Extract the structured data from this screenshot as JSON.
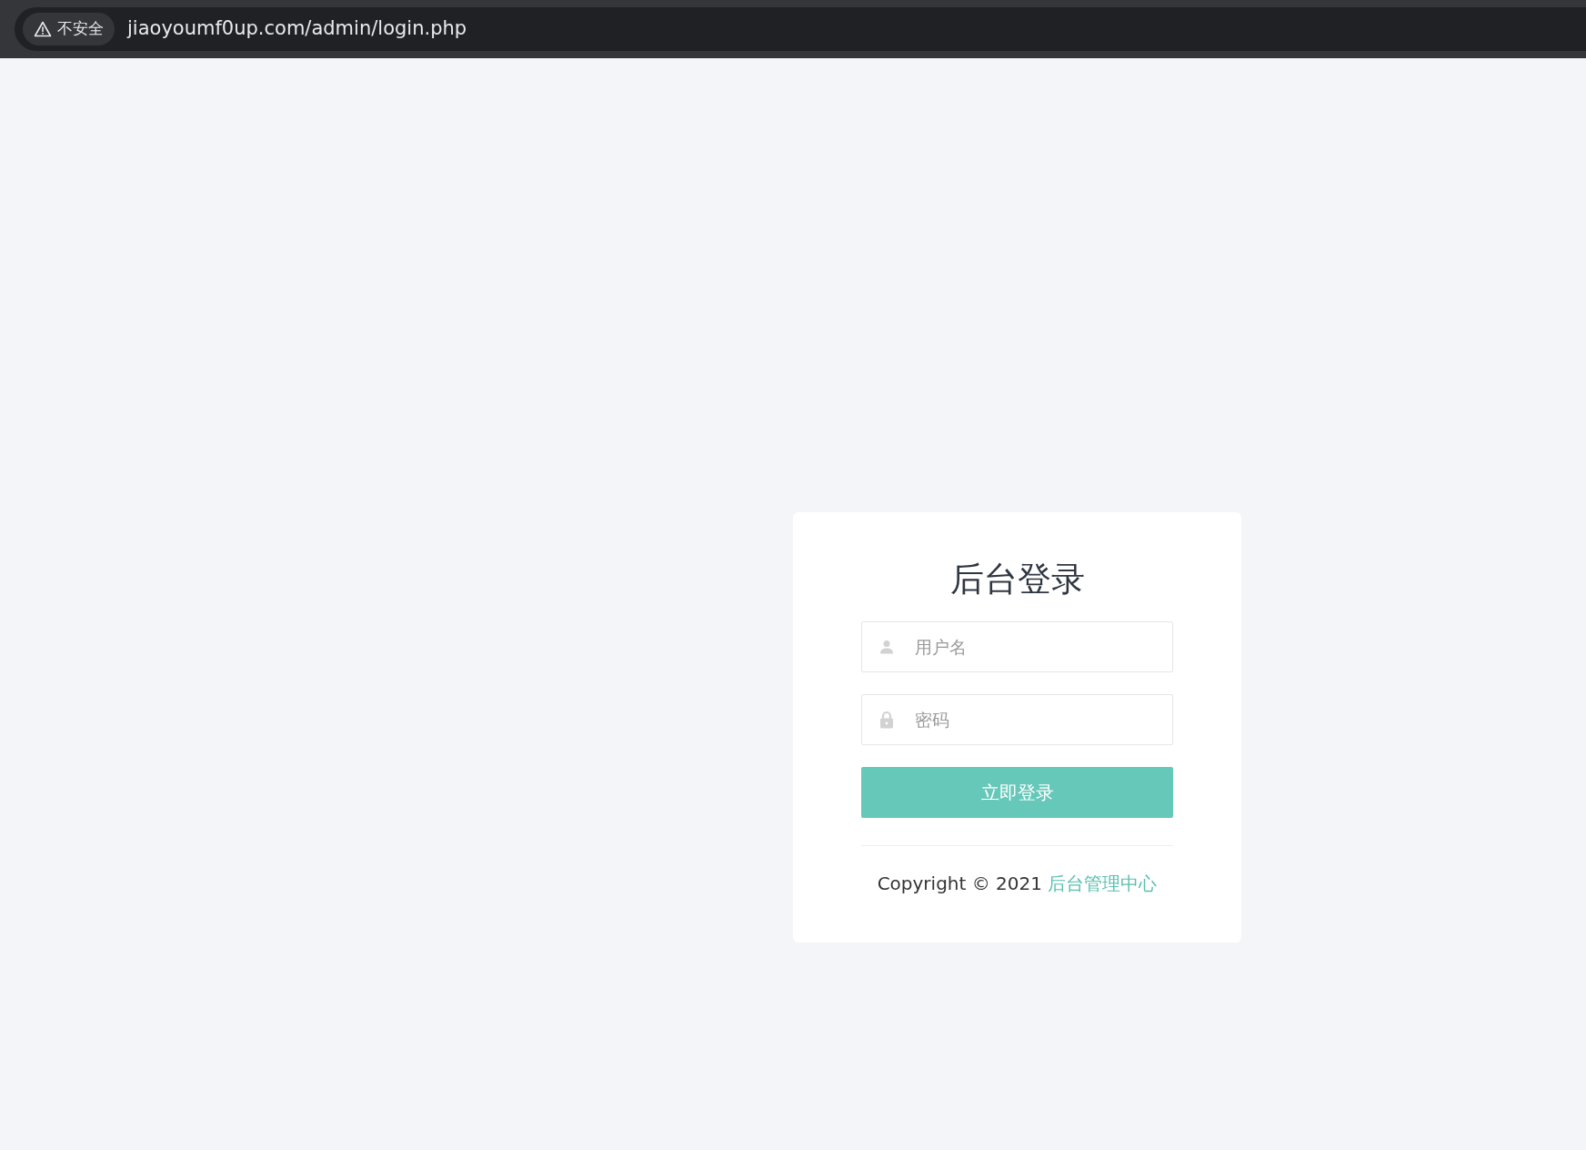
{
  "browser": {
    "security_label": "不安全",
    "url": "jiaoyoumf0up.com/admin/login.php"
  },
  "login": {
    "title": "后台登录",
    "fields": [
      {
        "kind": "text",
        "placeholder": "用户名"
      },
      {
        "kind": "password",
        "placeholder": "密码"
      }
    ],
    "submit": "立即登录",
    "copyright": "Copyright © 2021",
    "copyright_link": "后台管理中心"
  }
}
